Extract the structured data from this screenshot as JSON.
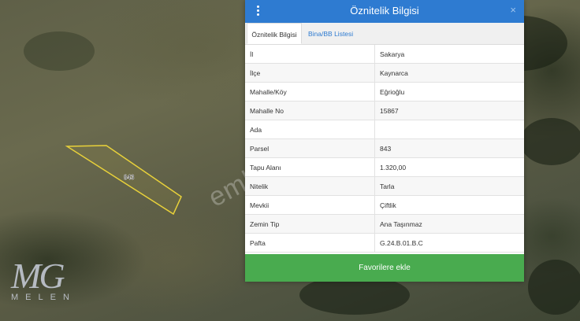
{
  "map": {
    "parcel_label": "843",
    "watermark": "emlakjet.com",
    "logo_mark": "MG",
    "logo_name": "MELEN",
    "parcel_outline_color": "#e8d13a"
  },
  "panel": {
    "title": "Öznitelik Bilgisi",
    "menu_icon": "vertical-dots-icon",
    "close_icon": "close-icon",
    "close_glyph": "×",
    "header_color": "#2e7bd1",
    "tabs": [
      {
        "label": "Öznitelik Bilgisi",
        "active": true
      },
      {
        "label": "Bina/BB Listesi",
        "active": false
      }
    ],
    "rows": [
      {
        "key": "İl",
        "value": "Sakarya"
      },
      {
        "key": "İlçe",
        "value": "Kaynarca"
      },
      {
        "key": "Mahalle/Köy",
        "value": "Eğrioğlu"
      },
      {
        "key": "Mahalle No",
        "value": "15867"
      },
      {
        "key": "Ada",
        "value": ""
      },
      {
        "key": "Parsel",
        "value": "843"
      },
      {
        "key": "Tapu Alanı",
        "value": "1.320,00"
      },
      {
        "key": "Nitelik",
        "value": "Tarla"
      },
      {
        "key": "Mevkii",
        "value": "Çiftlik"
      },
      {
        "key": "Zemin Tip",
        "value": "Ana Taşınmaz"
      },
      {
        "key": "Pafta",
        "value": "G.24.B.01.B.C"
      }
    ],
    "favorite_button": "Favorilere ekle",
    "button_color": "#49ab4f"
  }
}
